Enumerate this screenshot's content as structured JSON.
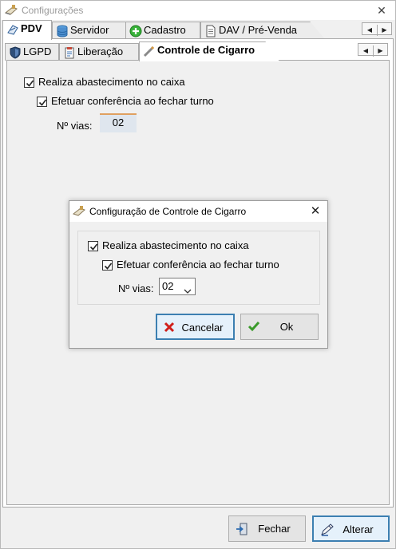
{
  "window": {
    "title": "Configurações"
  },
  "tabs": [
    {
      "label": "PDV"
    },
    {
      "label": "Servidor"
    },
    {
      "label": "Cadastro"
    },
    {
      "label": "DAV / Pré-Venda"
    }
  ],
  "subtabs": [
    {
      "label": "LGPD"
    },
    {
      "label": "Liberação"
    },
    {
      "label": "Controle de Cigarro"
    }
  ],
  "panel": {
    "realiza_label": "Realiza abastecimento no caixa",
    "realiza_checked": true,
    "efetuar_label": "Efetuar conferência ao fechar turno",
    "efetuar_checked": true,
    "vias_label": "Nº vias:",
    "vias_value": "02"
  },
  "dialog": {
    "title": "Configuração de Controle de Cigarro",
    "realiza_label": "Realiza abastecimento no caixa",
    "efetuar_label": "Efetuar conferência ao fechar turno",
    "vias_label": "Nº vias:",
    "vias_selected": "02",
    "cancel_label": "Cancelar",
    "ok_label": "Ok"
  },
  "footer": {
    "fechar_label": "Fechar",
    "alterar_label": "Alterar"
  },
  "colors": {
    "focus_border": "#3c7fb1",
    "cancel_icon": "#d0201c",
    "ok_icon": "#3a9a2a"
  }
}
